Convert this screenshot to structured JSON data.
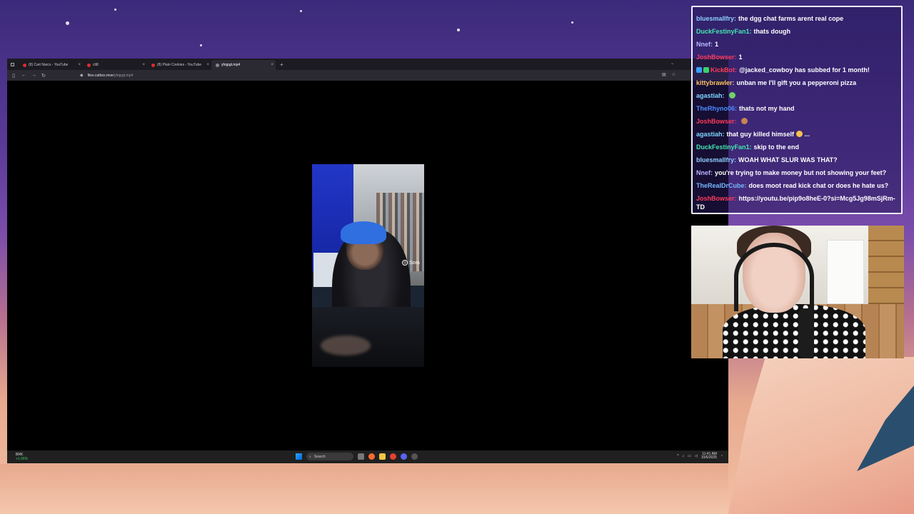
{
  "browser": {
    "tabs": [
      {
        "label": "(8) Cart Narcs - YouTube",
        "favicon": "youtube-icon",
        "active": false
      },
      {
        "label": "clt8",
        "favicon": "youtube-icon",
        "active": false
      },
      {
        "label": "(8) Plain Cookies - YouTube",
        "favicon": "youtube-icon",
        "active": false
      },
      {
        "label": "yhqpgt.mp4",
        "favicon": "file-icon",
        "active": true
      }
    ],
    "new_tab_label": "+",
    "url_host": "files.catbox.moe",
    "url_path": "/yhqpgt.mp4"
  },
  "video": {
    "watermark": "Sora"
  },
  "taskbar": {
    "weather_label": "BRK",
    "weather_change": "+1.06%",
    "search_placeholder": "Search",
    "time": "11:41 AM",
    "date": "10/6/2025"
  },
  "chat": {
    "messages": [
      {
        "user": "bluesmallfry",
        "color": "#8fd0ff",
        "text": "the dgg chat farms arent real cope",
        "badges": []
      },
      {
        "user": "DuckFestinyFan1",
        "color": "#45e6b0",
        "text": "thats dough",
        "badges": []
      },
      {
        "user": "Nnef",
        "color": "#b9b6ff",
        "text": "1",
        "badges": []
      },
      {
        "user": "JoshBowser",
        "color": "#ff3b5c",
        "text": "1",
        "badges": []
      },
      {
        "user": "KickBot",
        "color": "#ff3b5c",
        "text": "@jacked_cowboy has subbed for 1 month!",
        "badges": [
          "#3aa0ff",
          "#37d36b"
        ]
      },
      {
        "user": "kittybrawler",
        "color": "#ffc46b",
        "text": "unban me I'll gift you a pepperoni pizza",
        "badges": []
      },
      {
        "user": "agastiah",
        "color": "#7fd6ff",
        "text": "",
        "badges": [],
        "emote": "#6fd36a"
      },
      {
        "user": "TheRhyno06",
        "color": "#4a8cff",
        "text": "thats not my hand",
        "badges": []
      },
      {
        "user": "JoshBowser",
        "color": "#ff3b5c",
        "text": "",
        "badges": [],
        "emote": "#c98355"
      },
      {
        "user": "agastiah",
        "color": "#7fd6ff",
        "text": "that guy killed himself",
        "badges": [],
        "emote": "#f6c34a",
        "suffix": "..."
      },
      {
        "user": "DuckFestinyFan1",
        "color": "#45e6b0",
        "text": "skip to the end",
        "badges": []
      },
      {
        "user": "bluesmallfry",
        "color": "#8fd0ff",
        "text": "WOAH WHAT SLUR WAS THAT?",
        "badges": []
      },
      {
        "user": "Nnef",
        "color": "#b9b6ff",
        "text": "you're trying to make money but not showing your feet?",
        "badges": []
      },
      {
        "user": "TheRealDrCube",
        "color": "#74b9ff",
        "text": "does moot read kick chat or does he hate us?",
        "badges": []
      },
      {
        "user": "JoshBowser",
        "color": "#ff3b5c",
        "text": "https://youtu.be/pip9o8heE-0?si=Mcg5Jg98mSjRm-TD",
        "badges": [],
        "wrap": true
      }
    ]
  },
  "colors": {
    "chat_border": "#f2edff",
    "browser_tab_bg": "#1c1b22",
    "browser_nav_bg": "#2b2a33",
    "taskbar_bg": "#202020"
  }
}
